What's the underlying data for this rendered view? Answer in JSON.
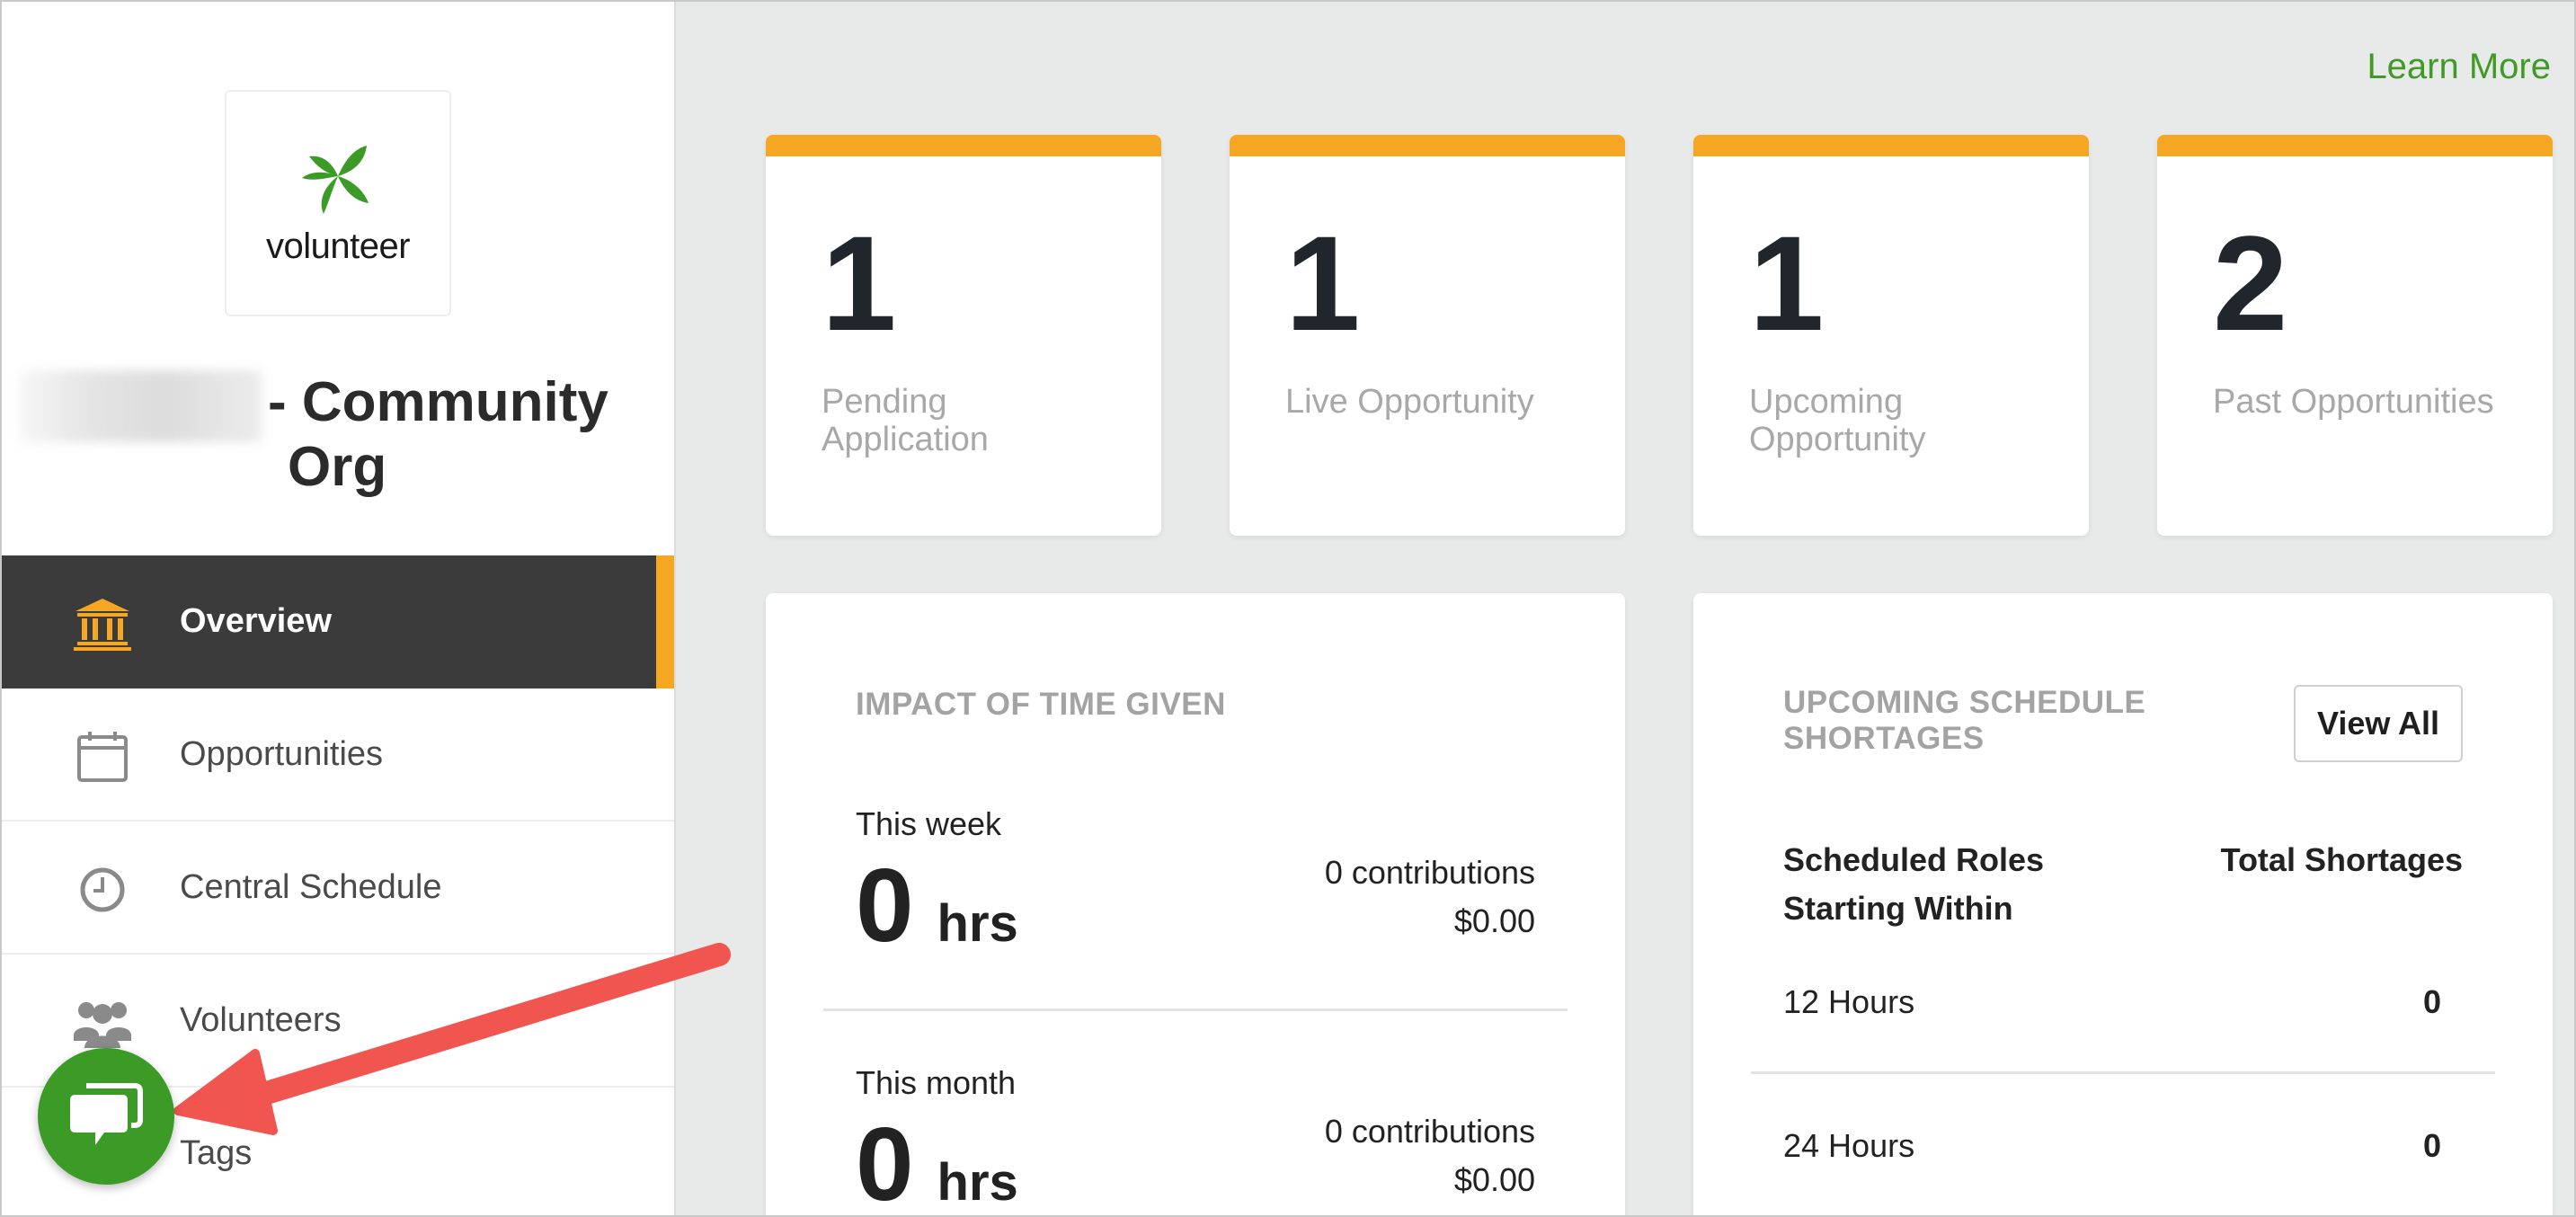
{
  "sidebar": {
    "logo_text": "volunteer",
    "org_title_line1": "- Community",
    "org_title_line2": "Org",
    "items": [
      {
        "label": "Overview",
        "icon": "bank-icon"
      },
      {
        "label": "Opportunities",
        "icon": "calendar-icon"
      },
      {
        "label": "Central Schedule",
        "icon": "clock-icon"
      },
      {
        "label": "Volunteers",
        "icon": "people-icon"
      },
      {
        "label": "Tags",
        "icon": "tag-icon"
      }
    ]
  },
  "header": {
    "learn_more": "Learn More"
  },
  "stats": [
    {
      "value": "1",
      "label": "Pending Application"
    },
    {
      "value": "1",
      "label": "Live Opportunity"
    },
    {
      "value": "1",
      "label": "Upcoming Opportunity"
    },
    {
      "value": "2",
      "label": "Past Opportunities"
    }
  ],
  "impact": {
    "title": "IMPACT OF TIME GIVEN",
    "rows": [
      {
        "period": "This week",
        "hours": "0",
        "unit": "hrs",
        "contributions": "0 contributions",
        "amount": "$0.00"
      },
      {
        "period": "This month",
        "hours": "0",
        "unit": "hrs",
        "contributions": "0 contributions",
        "amount": "$0.00"
      }
    ]
  },
  "shortages": {
    "title_line1": "UPCOMING SCHEDULE",
    "title_line2": "SHORTAGES",
    "view_all": "View All",
    "col1_line1": "Scheduled Roles",
    "col1_line2": "Starting Within",
    "col2": "Total Shortages",
    "rows": [
      {
        "window": "12 Hours",
        "count": "0"
      },
      {
        "window": "24 Hours",
        "count": "0"
      }
    ]
  },
  "colors": {
    "accent_orange": "#f5a623",
    "brand_green": "#3c9a27",
    "nav_active_bg": "#3b3b3b",
    "annotation_arrow": "#f0554f"
  }
}
